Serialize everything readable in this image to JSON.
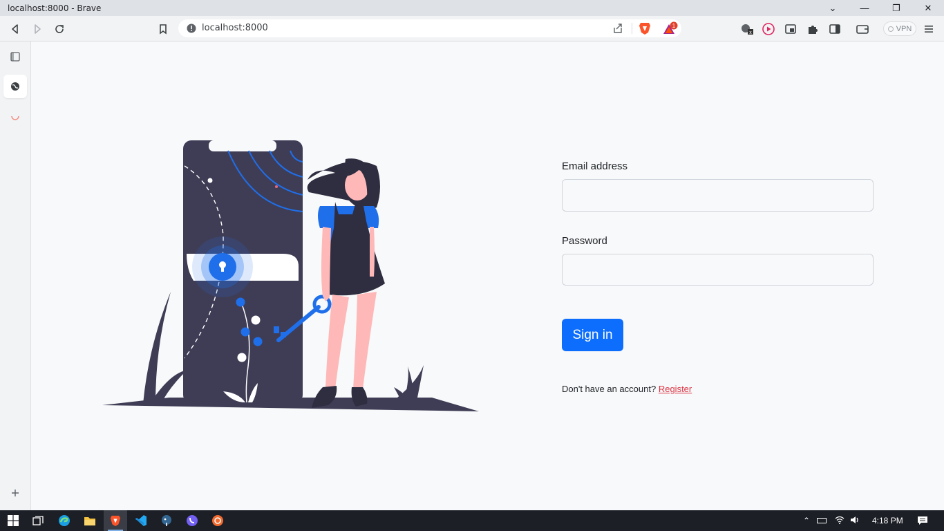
{
  "window": {
    "title": "localhost:8000 - Brave",
    "controls": [
      "chevron-down-icon",
      "minimize-icon",
      "restore-icon",
      "close-icon"
    ]
  },
  "toolbar": {
    "url": "localhost:8000",
    "rewards_badge": "1",
    "vpn_label": "VPN"
  },
  "sidepanel": {
    "items": [
      "sidebar-toggle-icon",
      "globe-icon",
      "loading-icon",
      "plus-icon"
    ]
  },
  "login": {
    "email_label": "Email address",
    "email_value": "",
    "password_label": "Password",
    "password_value": "",
    "submit_label": "Sign in",
    "register_prompt": "Don't have an account?",
    "register_link": "Register"
  },
  "colors": {
    "primary": "#0d6efd",
    "link": "#dc3545",
    "illustration_dark": "#3f3d56",
    "illustration_blue": "#1f6feb"
  },
  "taskbar": {
    "apps": [
      "windows-start-icon",
      "task-view-icon",
      "edge-icon",
      "file-explorer-icon",
      "brave-icon",
      "vscode-icon",
      "postgres-icon",
      "viber-icon",
      "app-icon"
    ],
    "time": "4:18 PM"
  }
}
